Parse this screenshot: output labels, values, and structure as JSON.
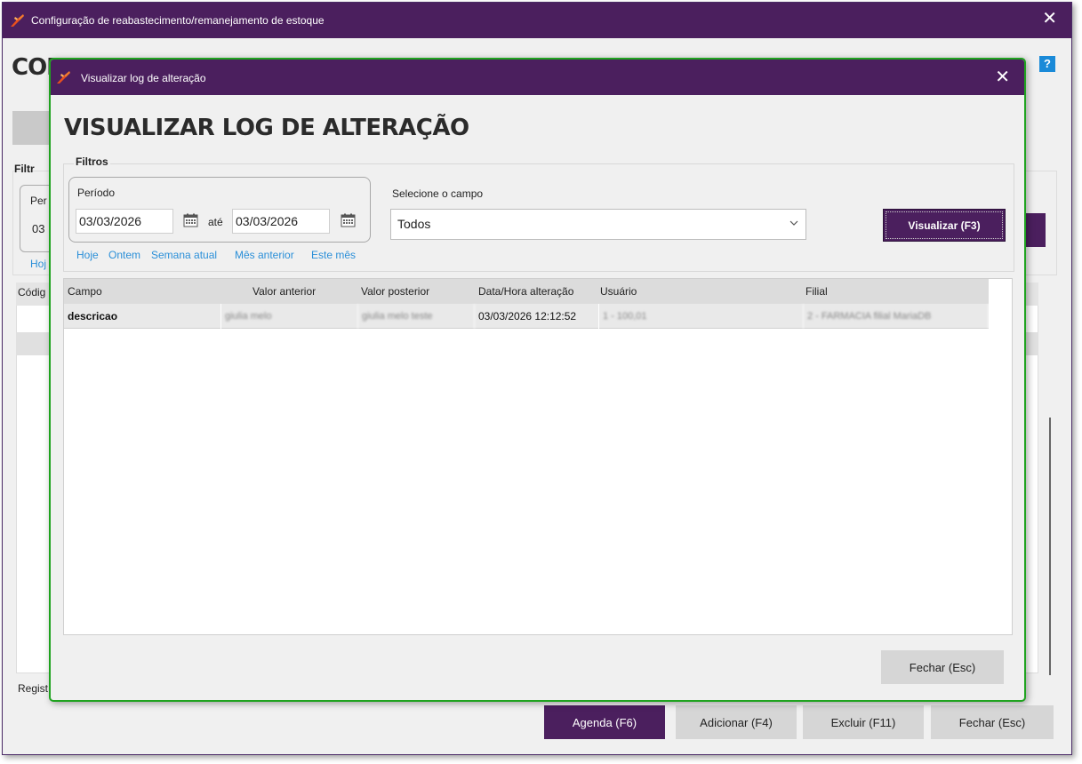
{
  "colors": {
    "titlebar": "#4b1f5e",
    "primary_button": "#4b1f5e",
    "link": "#2a8fd8",
    "modal_border": "#1fa31f"
  },
  "parent_window": {
    "title": "Configuração de reabastecimento/remanejamento de estoque",
    "heading_fragment": "CON",
    "help_label": "?",
    "filtros_fragment": "Filtr",
    "periodo_fragment": "Per",
    "date_fragment": "03",
    "hoje_fragment": "Hoj",
    "codigo_fragment": "Códig",
    "registros_fragment": "Regist",
    "buttons": {
      "agenda": "Agenda (F6)",
      "adicionar": "Adicionar (F4)",
      "excluir": "Excluir (F11)",
      "fechar": "Fechar (Esc)"
    }
  },
  "modal": {
    "title": "Visualizar log de alteração",
    "heading": "VISUALIZAR LOG DE ALTERAÇÃO",
    "filters": {
      "legend": "Filtros",
      "periodo_label": "Período",
      "date_from": "03/03/2026",
      "ate_label": "até",
      "date_to": "03/03/2026",
      "quick_links": [
        "Hoje",
        "Ontem",
        "Semana atual",
        "Mês anterior",
        "Este mês"
      ],
      "campo_label": "Selecione o campo",
      "campo_selected": "Todos",
      "visualizar_button": "Visualizar (F3)"
    },
    "table": {
      "columns": [
        "Campo",
        "Valor anterior",
        "Valor posterior",
        "Data/Hora alteração",
        "Usuário",
        "Filial"
      ],
      "rows": [
        {
          "campo": "descricao",
          "valor_anterior": "giulia melo",
          "valor_posterior": "giulia melo teste",
          "data_hora": "03/03/2026 12:12:52",
          "usuario": "1 - 100,01",
          "filial": "2 - FARMACIA filial MariaDB"
        }
      ]
    },
    "fechar_button": "Fechar (Esc)"
  }
}
